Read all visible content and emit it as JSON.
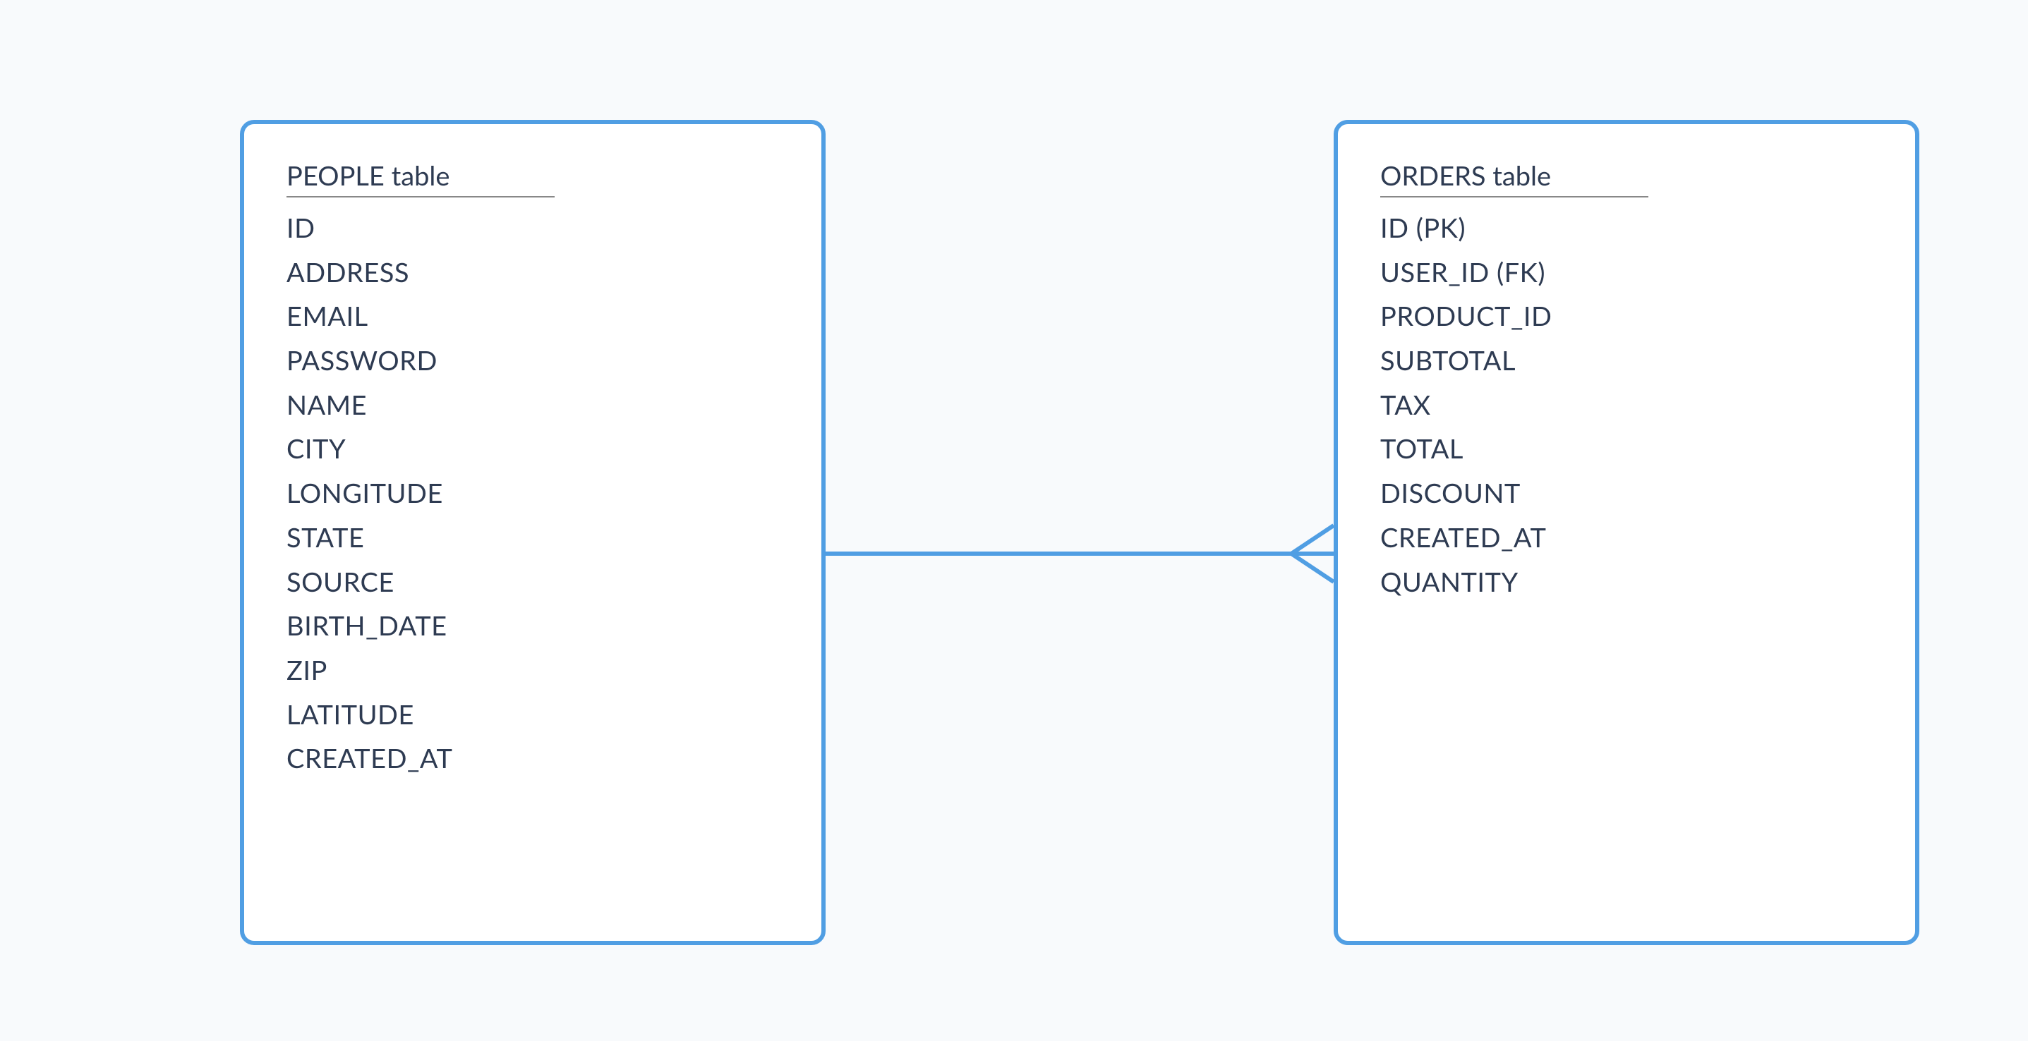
{
  "entities": {
    "people": {
      "title": "PEOPLE table",
      "fields": [
        "ID",
        "ADDRESS",
        "EMAIL",
        "PASSWORD",
        "NAME",
        "CITY",
        "LONGITUDE",
        "STATE",
        "SOURCE",
        "BIRTH_DATE",
        "ZIP",
        "LATITUDE",
        "CREATED_AT"
      ]
    },
    "orders": {
      "title": "ORDERS table",
      "fields": [
        "ID (PK)",
        "USER_ID (FK)",
        "PRODUCT_ID",
        "SUBTOTAL",
        "TAX",
        "TOTAL",
        "DISCOUNT",
        "CREATED_AT",
        "QUANTITY"
      ]
    }
  },
  "relationship": {
    "from": "people",
    "to": "orders",
    "cardinality": "one-to-many"
  },
  "colors": {
    "border": "#509ee3",
    "text": "#2e3b52",
    "background": "#f8fafc"
  }
}
